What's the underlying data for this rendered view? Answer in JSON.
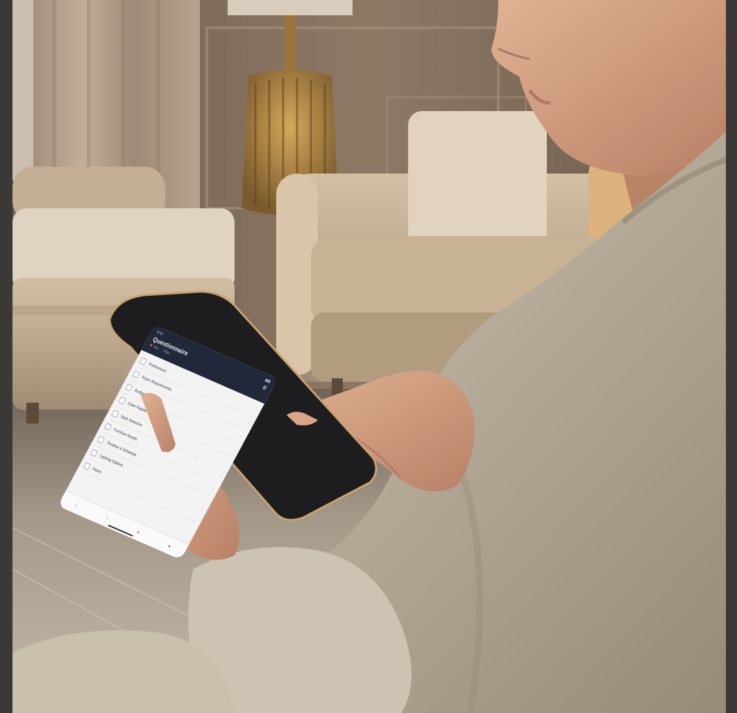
{
  "phone": {
    "status_time": "9:41",
    "status_icons": "▮▮▮",
    "title": "Questionnaire",
    "settings_icon": "gear-icon",
    "filter_label": "Sort",
    "filter_right": "Filter",
    "items": [
      {
        "label": "Preferences"
      },
      {
        "label": "Room Requirements"
      },
      {
        "label": "Budget Range"
      },
      {
        "label": "Color Palette"
      },
      {
        "label": "Style Selection"
      },
      {
        "label": "Furniture Needs"
      },
      {
        "label": "Timeline & Schedule"
      },
      {
        "label": "Lighting Options"
      },
      {
        "label": "Notes"
      }
    ],
    "tabs": [
      {
        "icon": "home-icon",
        "glyph": "⌂"
      },
      {
        "icon": "search-icon",
        "glyph": "⌕"
      },
      {
        "icon": "star-icon",
        "glyph": "★"
      },
      {
        "icon": "profile-icon",
        "glyph": "●"
      }
    ],
    "accent_color": "#e8893a",
    "header_color": "#22283a"
  },
  "scene": {
    "wall_color": "#8c7a66",
    "sofa_color": "#c9b59a",
    "jacket_color": "#b9ae9c"
  }
}
